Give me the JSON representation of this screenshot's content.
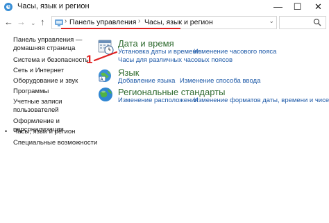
{
  "window": {
    "title": "Часы, язык и регион",
    "controls": {
      "minimize": "—",
      "maximize": "☐",
      "close": "✕"
    }
  },
  "address": {
    "back": "←",
    "forward": "→",
    "history": "⌄",
    "up": "↑",
    "crumbs": [
      "Панель управления",
      "Часы, язык и регион"
    ],
    "separator": "›",
    "dropdown": "⌄"
  },
  "sidebar": {
    "items": [
      {
        "lines": [
          "Панель управления —",
          "домашняя страница"
        ],
        "current": false
      },
      {
        "lines": [
          "Система и безопасность"
        ],
        "current": false
      },
      {
        "lines": [
          "Сеть и Интернет"
        ],
        "current": false
      },
      {
        "lines": [
          "Оборудование и звук"
        ],
        "current": false
      },
      {
        "lines": [
          "Программы"
        ],
        "current": false
      },
      {
        "lines": [
          "Учетные записи",
          "пользователей"
        ],
        "current": false
      },
      {
        "lines": [
          "Оформление и",
          "персонализация"
        ],
        "current": false
      },
      {
        "lines": [
          "Часы, язык и регион"
        ],
        "current": true
      },
      {
        "lines": [
          "Специальные возможности"
        ],
        "current": false
      }
    ],
    "bullet": "•"
  },
  "categories": [
    {
      "icon": "clock-calendar-icon",
      "title": "Дата и время",
      "links": [
        "Установка даты и времени",
        "Изменение часового пояса",
        "Часы для различных часовых поясов"
      ]
    },
    {
      "icon": "language-globe-icon",
      "title": "Язык",
      "links": [
        "Добавление языка",
        "Изменение способа ввода"
      ]
    },
    {
      "icon": "region-globe-icon",
      "title": "Региональные стандарты",
      "links": [
        "Изменение расположения",
        "Изменение форматов даты, времени и чисел"
      ]
    }
  ],
  "annotation": {
    "marker": "1",
    "color": "#e02020"
  },
  "colors": {
    "category_title": "#2f6b2f",
    "link": "#1e5aa8"
  }
}
